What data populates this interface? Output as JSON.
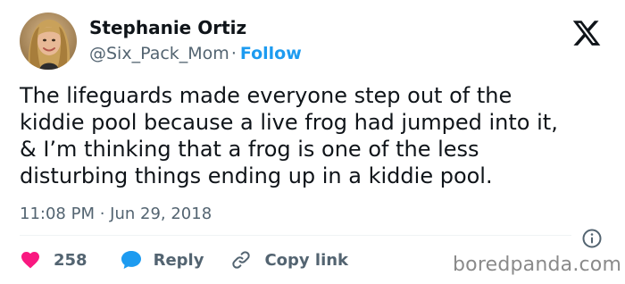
{
  "author": {
    "name": "Stephanie Ortiz",
    "handle": "@Six_Pack_Mom",
    "separator": "·",
    "follow_label": "Follow"
  },
  "tweet": {
    "text": "The lifeguards made everyone step out of the\nkiddie pool because a live frog had jumped into it,\n& I’m thinking that a frog is one of the less\ndisturbing things ending up in a kiddie pool.",
    "timestamp": "11:08 PM · Jun 29, 2018"
  },
  "actions": {
    "like_count": "258",
    "reply_label": "Reply",
    "copy_link_label": "Copy link"
  },
  "icons": {
    "brand": "x-logo-icon",
    "info": "info-icon",
    "like": "heart-icon",
    "reply": "speech-bubble-icon",
    "copy": "link-icon"
  },
  "colors": {
    "link_blue": "#1d9bf0",
    "like_pink": "#f91880",
    "muted_text": "#536471",
    "main_text": "#0f1419"
  },
  "watermark": "boredpanda.com"
}
